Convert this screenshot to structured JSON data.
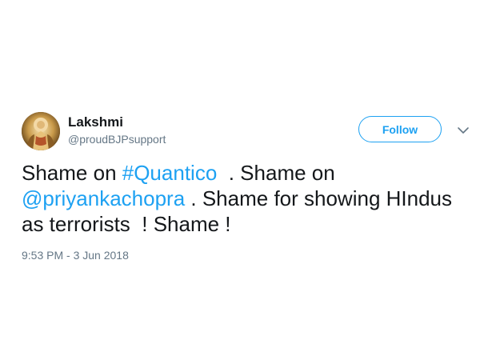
{
  "author": {
    "display_name": "Lakshmi",
    "handle": "@proudBJPsupport",
    "avatar_icon": "avatar-deity-image"
  },
  "follow_button": {
    "label": "Follow",
    "accent_color": "#1da1f2"
  },
  "menu_icon": "chevron-down-icon",
  "tweet": {
    "parts": [
      {
        "text": "Shame on ",
        "type": "text"
      },
      {
        "text": "#Quantico",
        "type": "hashtag"
      },
      {
        "text": "  . Shame on ",
        "type": "text"
      },
      {
        "text": "@priyankachopra",
        "type": "mention"
      },
      {
        "text": " . Shame for showing HIndus as terrorists  ! Shame !",
        "type": "text"
      }
    ]
  },
  "timestamp": "9:53 PM - 3 Jun 2018",
  "colors": {
    "link": "#1da1f2",
    "text": "#14171a",
    "muted": "#657786"
  }
}
